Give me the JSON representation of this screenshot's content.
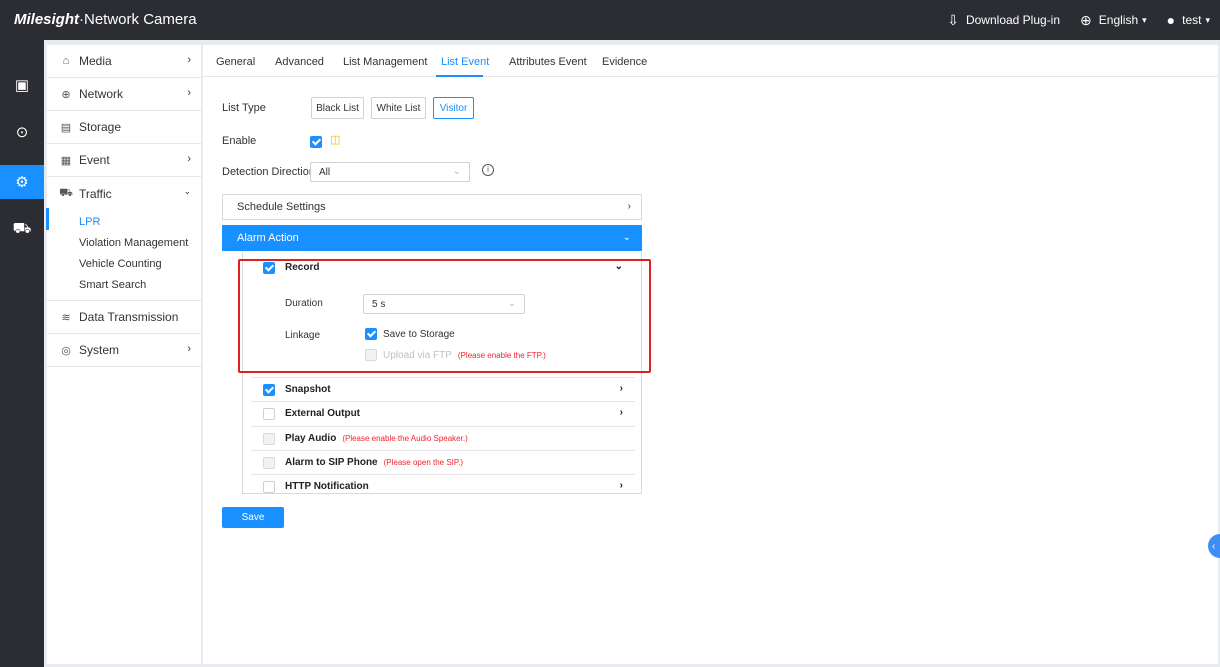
{
  "header": {
    "brand": "Milesight",
    "product": "·Network Camera",
    "download": "Download Plug-in",
    "language": "English",
    "user": "test"
  },
  "rail": {
    "items": [
      {
        "icon": "live-view-icon"
      },
      {
        "icon": "playback-icon"
      },
      {
        "icon": "settings-icon",
        "active": true
      },
      {
        "icon": "vehicle-icon"
      }
    ]
  },
  "nav": {
    "media": "Media",
    "network": "Network",
    "storage": "Storage",
    "event": "Event",
    "traffic": "Traffic",
    "traffic_sub": [
      "LPR",
      "Violation Management",
      "Vehicle Counting",
      "Smart Search"
    ],
    "data_transmission": "Data Transmission",
    "system": "System"
  },
  "tabs": [
    "General",
    "Advanced",
    "List Management",
    "List Event",
    "Attributes Event",
    "Evidence"
  ],
  "active_tab": "List Event",
  "form": {
    "list_type_label": "List Type",
    "list_types": [
      "Black List",
      "White List",
      "Visitor"
    ],
    "selected_list_type": "Visitor",
    "enable_label": "Enable",
    "enable_checked": true,
    "direction_label": "Detection Direction",
    "direction_value": "All",
    "schedule_settings": "Schedule Settings",
    "alarm_action": "Alarm Action"
  },
  "record": {
    "label": "Record",
    "checked": true,
    "duration_label": "Duration",
    "duration_value": "5 s",
    "linkage_label": "Linkage",
    "save_to_storage": "Save to Storage",
    "save_to_storage_checked": true,
    "upload_ftp": "Upload via FTP",
    "upload_ftp_hint": "(Please enable the FTP.)"
  },
  "actions": {
    "snapshot": "Snapshot",
    "external_output": "External Output",
    "play_audio": "Play Audio",
    "play_audio_hint": "(Please enable the Audio Speaker.)",
    "alarm_sip": "Alarm to SIP Phone",
    "alarm_sip_hint": "(Please open the SIP.)",
    "http_notification": "HTTP Notification"
  },
  "save_label": "Save",
  "colors": {
    "accent": "#1890ff",
    "topbar": "#2b2d33",
    "warning": "#f5222d",
    "highlight_box": "#e02020"
  }
}
